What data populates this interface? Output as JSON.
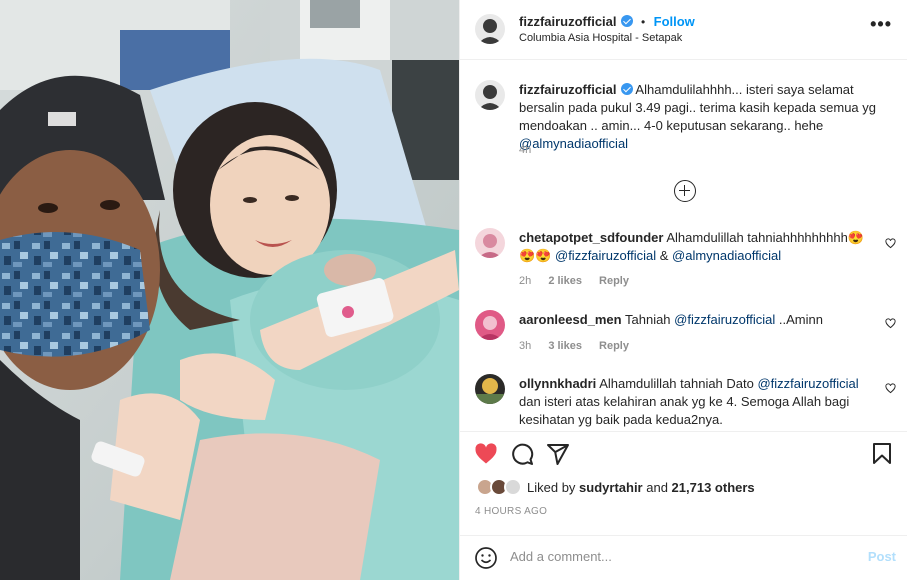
{
  "header": {
    "username": "fizzfairuzofficial",
    "follow_label": "Follow",
    "separator": "•",
    "location": "Columbia Asia Hospital - Setapak",
    "more_label": "•••"
  },
  "caption": {
    "username": "fizzfairuzofficial",
    "text": "Alhamdulilahhhh... isteri saya selamat bersalin pada pukul 3.49 pagi.. terima kasih kepada semua yg mendoakan .. amin... 4-0 keputusan sekarang.. hehe ",
    "mention": "@almynadiaofficial",
    "time": "4h"
  },
  "comments": [
    {
      "username": "chetapotpet_sdfounder",
      "text": "Alhamdulillah tahniahhhhhhhhh😍😍😍 ",
      "mention1": "@fizzfairuzofficial",
      "joiner": " & ",
      "mention2": "@almynadiaofficial",
      "time": "2h",
      "likes": "2 likes",
      "reply": "Reply"
    },
    {
      "username": "aaronleesd_men",
      "text_before": "Tahniah ",
      "mention": "@fizzfairuzofficial",
      "text_after": " ..Aminn",
      "time": "3h",
      "likes": "3 likes",
      "reply": "Reply"
    },
    {
      "username": "ollynnkhadri",
      "text_before": "Alhamdulillah tahniah Dato ",
      "mention": "@fizzfairuzofficial",
      "text_after": " dan isteri atas kelahiran anak yg ke 4. Semoga Allah bagi kesihatan yg baik pada kedua2nya."
    }
  ],
  "actions": {
    "liked_by_prefix": "Liked by ",
    "liked_by_user": "sudyrtahir",
    "and_label": " and ",
    "others": "21,713 others",
    "time_ago": "4 HOURS AGO"
  },
  "add_comment": {
    "placeholder": "Add a comment...",
    "post_label": "Post"
  },
  "colors": {
    "accent": "#0095f6",
    "like_red": "#ed4956",
    "mention": "#00376b",
    "muted": "#8e8e8e"
  }
}
